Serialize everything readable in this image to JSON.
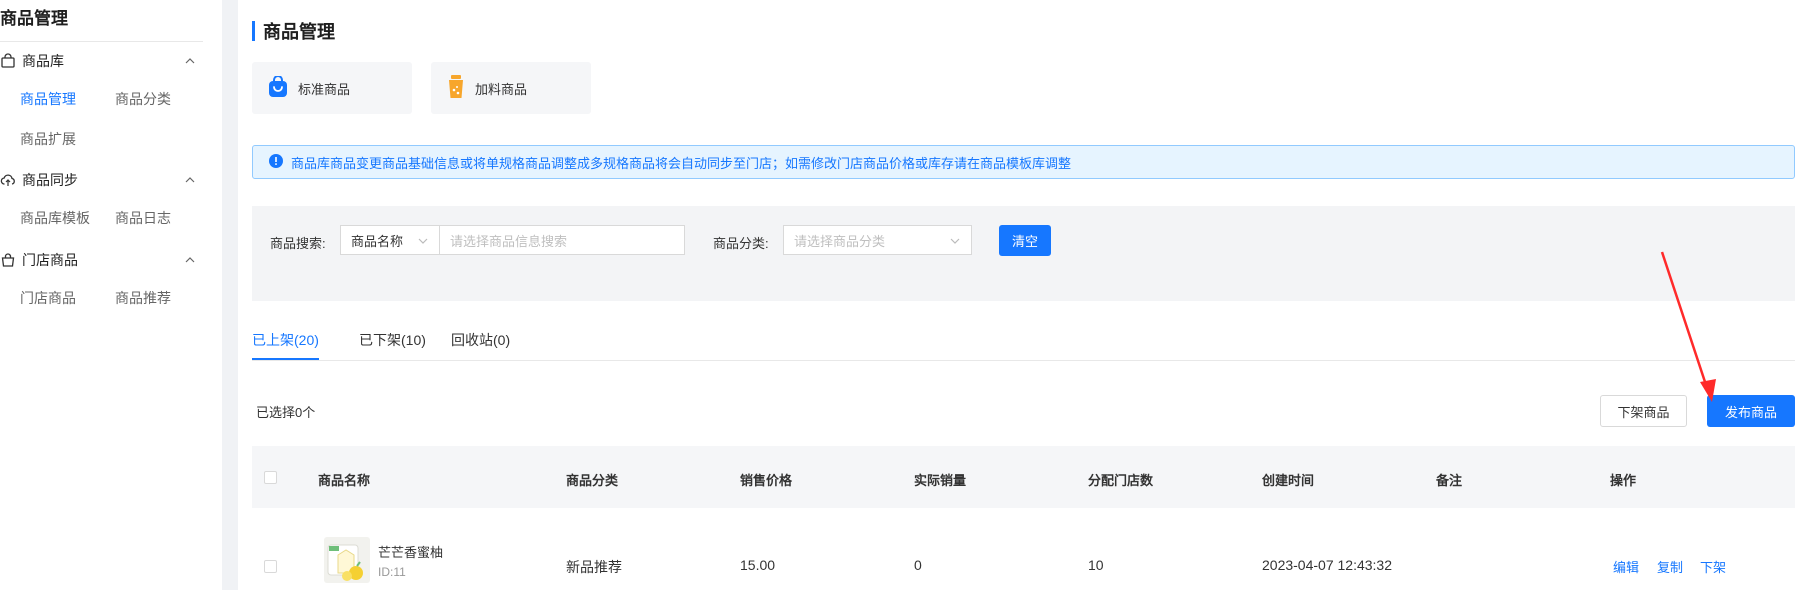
{
  "sidebar": {
    "title": "商品管理",
    "groups": [
      {
        "label": "商品库",
        "items": [
          "商品管理",
          "商品分类",
          "商品扩展"
        ]
      },
      {
        "label": "商品同步",
        "items": [
          "商品库模板",
          "商品日志"
        ]
      },
      {
        "label": "门店商品",
        "items": [
          "门店商品",
          "商品推荐"
        ]
      }
    ]
  },
  "page": {
    "title": "商品管理"
  },
  "type_cards": [
    {
      "label": "标准商品",
      "icon": "shopping-bag-icon"
    },
    {
      "label": "加料商品",
      "icon": "drink-icon"
    }
  ],
  "notice": {
    "text": "商品库商品变更商品基础信息或将单规格商品调整成多规格商品将会自动同步至门店；如需修改门店商品价格或库存请在商品模板库调整"
  },
  "filter": {
    "search_label": "商品搜索:",
    "search_type": "商品名称",
    "search_placeholder": "请选择商品信息搜索",
    "category_label": "商品分类:",
    "category_placeholder": "请选择商品分类",
    "clear_button": "清空"
  },
  "tabs": [
    "已上架(20)",
    "已下架(10)",
    "回收站(0)"
  ],
  "toolbar": {
    "selected_count": "已选择0个",
    "unlist_button": "下架商品",
    "publish_button": "发布商品"
  },
  "table": {
    "columns": [
      "商品名称",
      "商品分类",
      "销售价格",
      "实际销量",
      "分配门店数",
      "创建时间",
      "备注",
      "操作"
    ],
    "rows": [
      {
        "name": "芒芒香蜜柚",
        "id": "ID:11",
        "category": "新品推荐",
        "price": "15.00",
        "sales": "0",
        "stores": "10",
        "created": "2023-04-07 12:43:32",
        "note": "",
        "actions": [
          "编辑",
          "复制",
          "下架"
        ]
      }
    ]
  },
  "colors": {
    "primary": "#1677ff",
    "annotation_arrow": "#ff2a2a"
  }
}
